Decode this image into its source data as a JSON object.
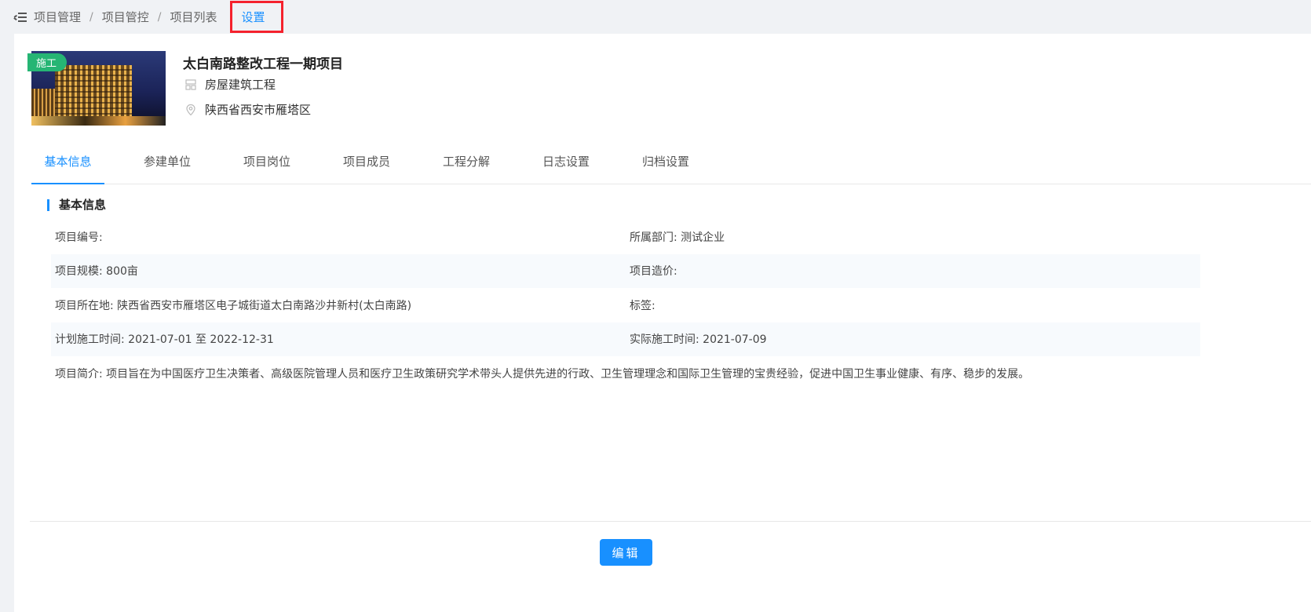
{
  "breadcrumb": {
    "items": [
      "项目管理",
      "项目管控",
      "项目列表"
    ],
    "separator": "/",
    "current": "设置"
  },
  "project": {
    "status_badge": "施工",
    "title": "太白南路整改工程一期项目",
    "category": "房屋建筑工程",
    "location": "陕西省西安市雁塔区"
  },
  "tabs": [
    {
      "label": "基本信息",
      "active": true
    },
    {
      "label": "参建单位",
      "active": false
    },
    {
      "label": "项目岗位",
      "active": false
    },
    {
      "label": "项目成员",
      "active": false
    },
    {
      "label": "工程分解",
      "active": false
    },
    {
      "label": "日志设置",
      "active": false
    },
    {
      "label": "归档设置",
      "active": false
    }
  ],
  "section": {
    "title": "基本信息",
    "rows": [
      {
        "left": "项目编号:",
        "right": "所属部门: 测试企业"
      },
      {
        "left": "项目规模: 800亩",
        "right": "项目造价:"
      },
      {
        "left": "项目所在地: 陕西省西安市雁塔区电子城街道太白南路沙井新村(太白南路)",
        "right": "标签:"
      },
      {
        "left": "计划施工时间: 2021-07-01 至 2022-12-31",
        "right": "实际施工时间: 2021-07-09"
      },
      {
        "left": "项目简介: 项目旨在为中国医疗卫生决策者、高级医院管理人员和医疗卫生政策研究学术带头人提供先进的行政、卫生管理理念和国际卫生管理的宝贵经验，促进中国卫生事业健康、有序、稳步的发展。",
        "right": ""
      }
    ]
  },
  "actions": {
    "edit_label": "编辑"
  },
  "colors": {
    "accent": "#1890ff",
    "badge": "#26b574",
    "highlight_border": "#f5222d"
  },
  "icons": {
    "menu": "menu-collapse-icon",
    "category": "building-icon",
    "location": "location-pin-icon"
  }
}
